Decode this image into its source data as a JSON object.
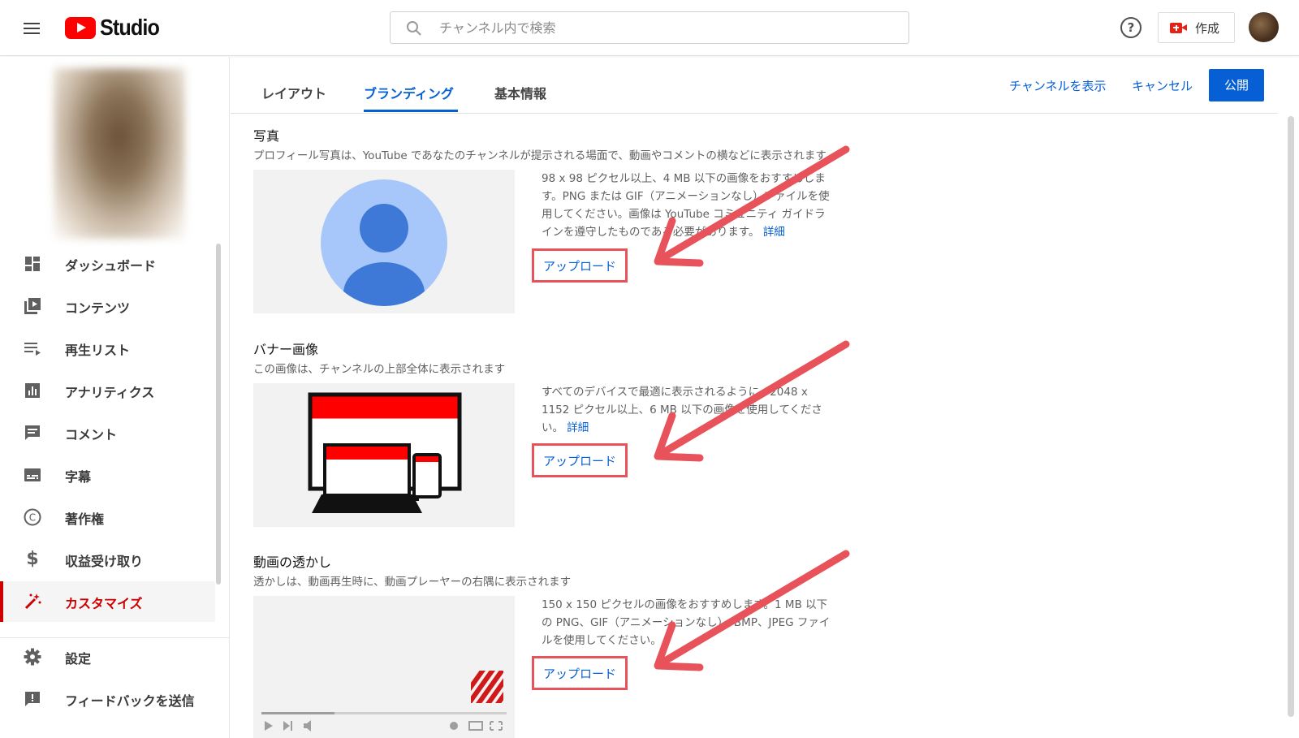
{
  "header": {
    "logo_text": "Studio",
    "search_placeholder": "チャンネル内で検索",
    "create_label": "作成",
    "help_glyph": "?"
  },
  "sidebar": {
    "items": [
      {
        "label": "ダッシュボード",
        "icon": "dashboard-icon"
      },
      {
        "label": "コンテンツ",
        "icon": "content-icon"
      },
      {
        "label": "再生リスト",
        "icon": "playlist-icon"
      },
      {
        "label": "アナリティクス",
        "icon": "analytics-icon"
      },
      {
        "label": "コメント",
        "icon": "comment-icon"
      },
      {
        "label": "字幕",
        "icon": "subtitles-icon"
      },
      {
        "label": "著作権",
        "icon": "copyright-icon"
      },
      {
        "label": "収益受け取り",
        "icon": "dollar-icon"
      },
      {
        "label": "カスタマイズ",
        "icon": "magic-wand-icon",
        "active": true
      },
      {
        "label": "設定",
        "icon": "gear-icon"
      },
      {
        "label": "フィードバックを送信",
        "icon": "feedback-icon"
      }
    ],
    "copyright_glyph": "©",
    "dollar_glyph": "$"
  },
  "tabs": [
    {
      "label": "レイアウト"
    },
    {
      "label": "ブランディング",
      "active": true
    },
    {
      "label": "基本情報"
    }
  ],
  "actions": {
    "view_channel": "チャンネルを表示",
    "cancel": "キャンセル",
    "publish": "公開"
  },
  "sections": {
    "photo": {
      "title": "写真",
      "description": "プロフィール写真は、YouTube であなたのチャンネルが提示される場面で、動画やコメントの横などに表示されます。",
      "info": "98 x 98 ピクセル以上、4 MB 以下の画像をおすすめします。PNG または GIF（アニメーションなし）ファイルを使用してください。画像は YouTube コミュニティ ガイドラインを遵守したものである必要があります。",
      "more": "詳細",
      "upload": "アップロード"
    },
    "banner": {
      "title": "バナー画像",
      "description": "この画像は、チャンネルの上部全体に表示されます",
      "info": "すべてのデバイスで最適に表示されるように、2048 x 1152 ピクセル以上、6 MB 以下の画像を使用してください。",
      "more": "詳細",
      "upload": "アップロード"
    },
    "watermark": {
      "title": "動画の透かし",
      "description": "透かしは、動画再生時に、動画プレーヤーの右隅に表示されます",
      "info": "150 x 150 ピクセルの画像をおすすめします。1 MB 以下の PNG、GIF（アニメーションなし）、BMP、JPEG ファイルを使用してください。",
      "upload": "アップロード"
    }
  },
  "colors": {
    "accent_blue": "#065fd4",
    "youtube_red": "#ff0000",
    "annotation_red": "#e8525a",
    "active_nav_red": "#cc0000"
  }
}
